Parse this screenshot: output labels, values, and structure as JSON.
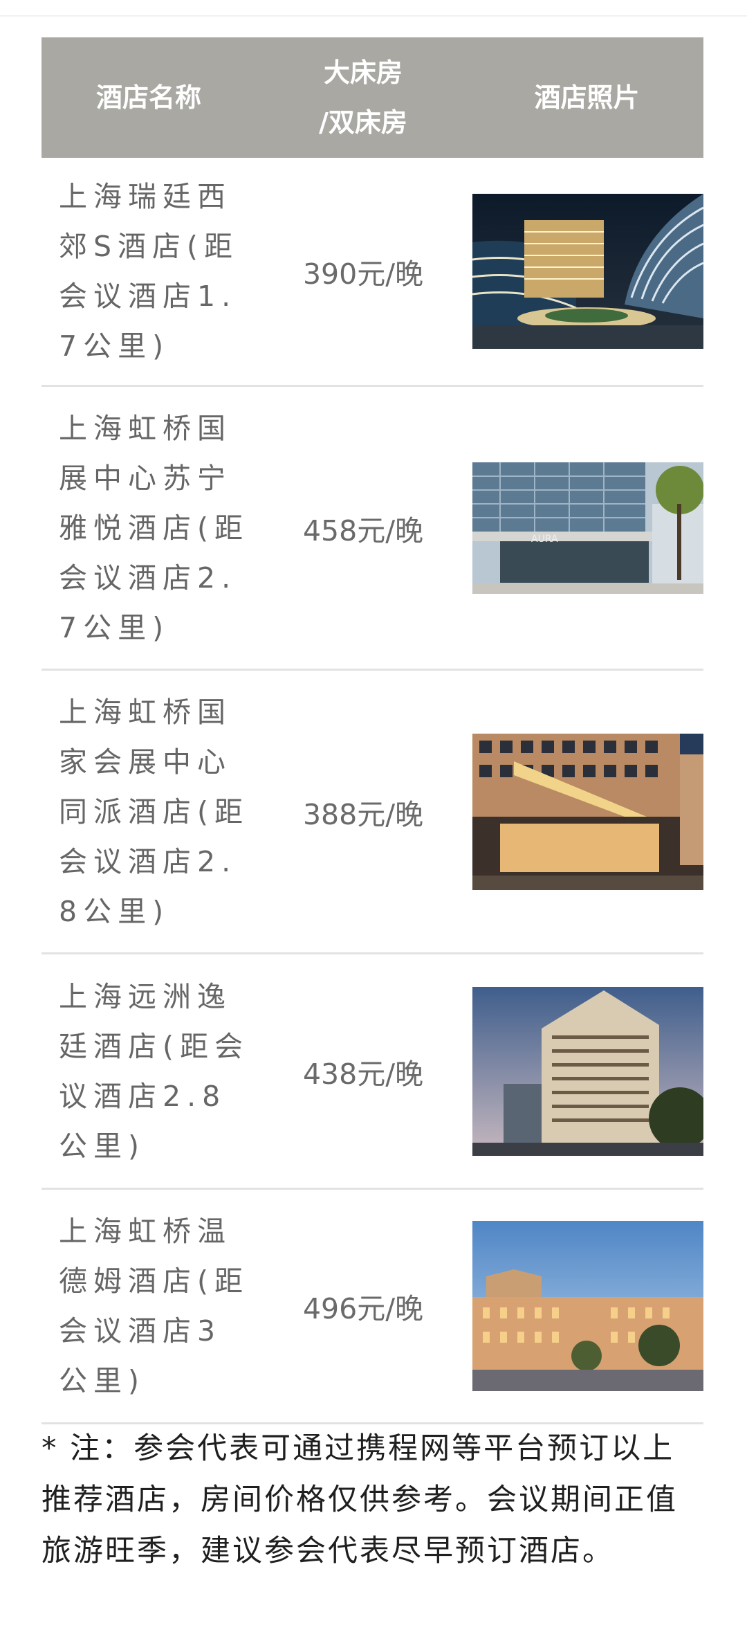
{
  "table": {
    "headers": [
      "酒店名称",
      "大床房/双床房",
      "酒店照片"
    ],
    "header_room_line1": "大床房",
    "header_room_line2": "/双床房",
    "rows": [
      {
        "name": "上海瑞廷西郊S酒店(距会议酒店1.7公里)",
        "price": "390元/晚",
        "photo": "hotel-1-photo"
      },
      {
        "name": "上海虹桥国展中心苏宁雅悦酒店(距会议酒店2.7公里)",
        "price": "458元/晚",
        "photo": "hotel-2-photo"
      },
      {
        "name": "上海虹桥国家会展中心同派酒店(距会议酒店2.8公里)",
        "price": "388元/晚",
        "photo": "hotel-3-photo"
      },
      {
        "name": "上海远洲逸廷酒店(距会议酒店2.8公里)",
        "price": "438元/晚",
        "photo": "hotel-4-photo"
      },
      {
        "name": "上海虹桥温德姆酒店(距会议酒店3公里)",
        "price": "496元/晚",
        "photo": "hotel-5-photo"
      }
    ]
  },
  "note": "* 注：参会代表可通过携程网等平台预订以上推荐酒店，房间价格仅供参考。会议期间正值旅游旺季，建议参会代表尽早预订酒店。",
  "colors": {
    "header_bg": "#a9a8a3",
    "header_text": "#ffffff",
    "body_text": "#666666",
    "divider": "#e2e2e2"
  }
}
